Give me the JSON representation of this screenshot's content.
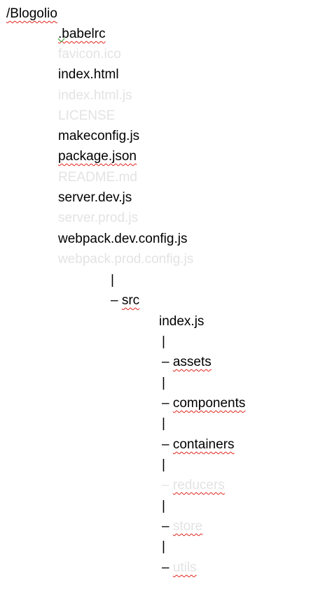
{
  "root": {
    "label": "/Blogolio"
  },
  "root_files": [
    {
      "name": ".babelrc",
      "muted": false
    },
    {
      "name": "favicon.ico",
      "muted": true
    },
    {
      "name": "index.html",
      "muted": false
    },
    {
      "name": "index.html.js",
      "muted": true
    },
    {
      "name": "LICENSE",
      "muted": true
    },
    {
      "name": "makeconfig.js",
      "muted": false
    },
    {
      "name": "package.json",
      "muted": false
    },
    {
      "name": "README.md",
      "muted": true
    },
    {
      "name": "server.dev.js",
      "muted": false
    },
    {
      "name": "server.prod.js",
      "muted": true
    },
    {
      "name": "webpack.dev.config.js",
      "muted": false
    },
    {
      "name": "webpack.prod.config.js",
      "muted": true
    }
  ],
  "tree": {
    "pipe": "|",
    "branch_dash": "–",
    "src": {
      "label": "src"
    },
    "src_file": {
      "label": "index.js"
    },
    "folders": [
      {
        "name": "assets",
        "muted": false
      },
      {
        "name": "components",
        "muted": false
      },
      {
        "name": "containers",
        "muted": false
      },
      {
        "name": "reducers",
        "muted": true
      },
      {
        "name": "store",
        "muted": true
      },
      {
        "name": "utils",
        "muted": true
      }
    ]
  },
  "colors": {
    "text": "#000000",
    "muted_text": "#e3e3e3",
    "spellcheck_underline": "#e0241b",
    "grammar_mark": "#2a9d2a"
  }
}
